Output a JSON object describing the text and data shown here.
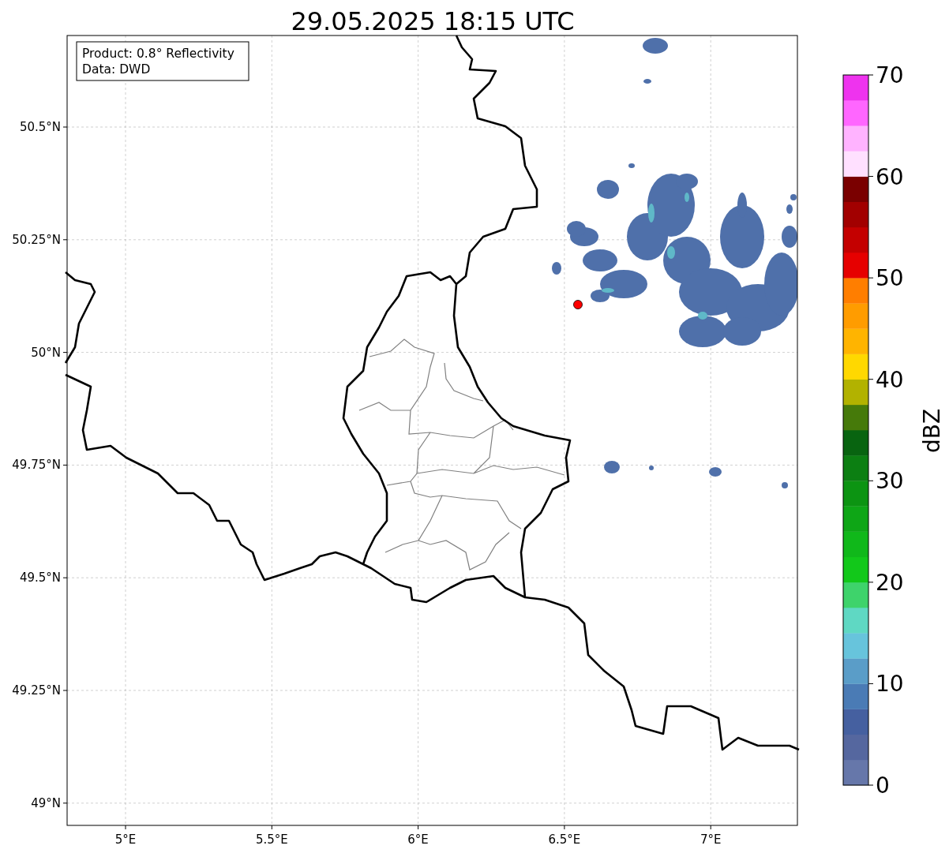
{
  "title": "29.05.2025 18:15 UTC",
  "info_box": [
    "Product: 0.8° Reflectivity",
    "Data: DWD"
  ],
  "y_ticks": [
    "50.5°N",
    "50.25°N",
    "50°N",
    "49.75°N",
    "49.5°N",
    "49.25°N",
    "49°N"
  ],
  "x_ticks": [
    "5°E",
    "5.5°E",
    "6°E",
    "6.5°E",
    "7°E"
  ],
  "colorbar": {
    "label": "dBZ",
    "ticks": [
      "70",
      "60",
      "50",
      "40",
      "30",
      "20",
      "10",
      "0"
    ],
    "bins": [
      {
        "color": "#6677aa"
      },
      {
        "color": "#55679f"
      },
      {
        "color": "#4560a0"
      },
      {
        "color": "#4a7bb5"
      },
      {
        "color": "#5a9dc8"
      },
      {
        "color": "#67c4dc"
      },
      {
        "color": "#5fd8c3"
      },
      {
        "color": "#3ed36b"
      },
      {
        "color": "#12c81a"
      },
      {
        "color": "#10b81a"
      },
      {
        "color": "#0ea616"
      },
      {
        "color": "#0c9412"
      },
      {
        "color": "#0c7f12"
      },
      {
        "color": "#086410"
      },
      {
        "color": "#467a0a"
      },
      {
        "color": "#b2b200"
      },
      {
        "color": "#ffd800"
      },
      {
        "color": "#ffb400"
      },
      {
        "color": "#ff9c00"
      },
      {
        "color": "#ff7e00"
      },
      {
        "color": "#e60000"
      },
      {
        "color": "#c40000"
      },
      {
        "color": "#a20000"
      },
      {
        "color": "#7a0000"
      },
      {
        "color": "#ffe0ff"
      },
      {
        "color": "#ffb3ff"
      },
      {
        "color": "#ff66ff"
      },
      {
        "color": "#ee33ee"
      }
    ]
  }
}
